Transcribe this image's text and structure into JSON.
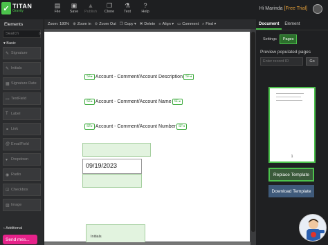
{
  "brand": {
    "title": "TITAN",
    "subtitle": "Gravity"
  },
  "toolbar": [
    {
      "label": "File",
      "icon": "file-icon",
      "glyph": "▤",
      "disabled": false
    },
    {
      "label": "Save",
      "icon": "save-icon",
      "glyph": "▣",
      "disabled": false
    },
    {
      "label": "Publish",
      "icon": "publish-icon",
      "glyph": "▲",
      "disabled": true
    },
    {
      "label": "Clone",
      "icon": "clone-icon",
      "glyph": "❐",
      "disabled": false
    },
    {
      "label": "Test",
      "icon": "test-icon",
      "glyph": "⚗",
      "disabled": false
    },
    {
      "label": "Help",
      "icon": "help-icon",
      "glyph": "?",
      "disabled": false
    }
  ],
  "user": {
    "greeting": "Hi Marinda",
    "trial": "[Free Trial]"
  },
  "sidebar": {
    "title": "Elements",
    "search_placeholder": "Search",
    "section_basic": "Basic",
    "items": [
      {
        "label": "Signature",
        "glyph": "✎"
      },
      {
        "label": "Initials",
        "glyph": "✎"
      },
      {
        "label": "Signature Date",
        "glyph": "▦"
      },
      {
        "label": "TextField",
        "glyph": "▭"
      },
      {
        "label": "Label",
        "glyph": "T"
      },
      {
        "label": "Link",
        "glyph": "⚭"
      },
      {
        "label": "EmailField",
        "glyph": "@"
      },
      {
        "label": "Dropdown",
        "glyph": "▾"
      },
      {
        "label": "Radio",
        "glyph": "◉"
      },
      {
        "label": "Checkbox",
        "glyph": "☑"
      },
      {
        "label": "Image",
        "glyph": "▨"
      }
    ],
    "section_additional": "Additional",
    "send_message": "Send mes..."
  },
  "subtoolbar": [
    {
      "label": "Zoom: 180%",
      "glyph": ""
    },
    {
      "label": "Zoom in",
      "glyph": "⊕"
    },
    {
      "label": "Zoom Out",
      "glyph": "⊖"
    },
    {
      "label": "Copy",
      "glyph": "❐"
    },
    {
      "label": "Delete",
      "glyph": "✖"
    },
    {
      "label": "Align",
      "glyph": "≡"
    },
    {
      "label": "Comment",
      "glyph": "▭"
    },
    {
      "label": "Find",
      "glyph": "⌕"
    }
  ],
  "canvas": {
    "sf_tag": "SF",
    "merge_fields": [
      "Account - Comment/Account Description",
      "Account - Comment/Account Name",
      "Account - Comment/Account Number"
    ],
    "date_value": "09/19/2023",
    "initials_label": "Initials"
  },
  "right_panel": {
    "tabs": [
      "Document",
      "Element"
    ],
    "subtabs": [
      "Settings",
      "Pages"
    ],
    "preview_label": "Preview populated pages",
    "record_placeholder": "Enter record ID",
    "go_label": "Go",
    "thumbnail_page": "1",
    "replace_label": "Replace Template",
    "download_label": "Download Template"
  },
  "colors": {
    "accent": "#4cc24c",
    "send_message": "#e6228a",
    "download": "#3f5a7a"
  }
}
